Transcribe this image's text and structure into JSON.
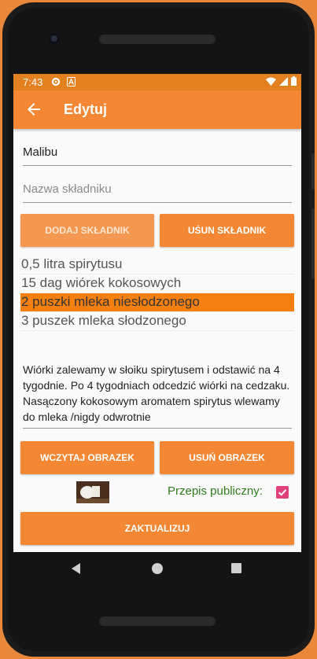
{
  "status_bar": {
    "time": "7:43"
  },
  "app_bar": {
    "title": "Edytuj"
  },
  "form": {
    "name_value": "Malibu",
    "ingredient_placeholder": "Nazwa składniku",
    "add_ingredient_label": "DODAJ SKŁADNIK",
    "remove_ingredient_label": "UŚUN SKŁADNIK"
  },
  "ingredients": [
    {
      "text": "0,5 litra spirytusu",
      "selected": false
    },
    {
      "text": "15 dag wiórek kokosowych",
      "selected": false
    },
    {
      "text": "2 puszki mleka niesłodzonego",
      "selected": true
    },
    {
      "text": "3 puszek mleka słodzonego",
      "selected": false
    }
  ],
  "description": "Wiórki zalewamy w słoiku spirytusem i odstawić na 4 tygodnie. Po 4 tygodniach odcedzić wiórki na cedzaku. Nasączony kokosowym aromatem spirytus wlewamy do mleka /nigdy odwrotnie",
  "image_buttons": {
    "load_label": "WCZYTAJ OBRAZEK",
    "remove_label": "USUŃ OBRAZEK"
  },
  "public": {
    "label": "Przepis publiczny:",
    "checked": true
  },
  "update_label": "ZAKTUALIZUJ",
  "colors": {
    "primary": "#f48734",
    "status_bar": "#e3801f",
    "selected_row": "#f5800f",
    "checkbox": "#e0407c",
    "public_label": "#2e7d1a"
  },
  "icons": {
    "status": [
      "settings-icon",
      "a-badge-icon",
      "wifi-icon",
      "signal-icon",
      "battery-icon"
    ],
    "back": "arrow-back-icon",
    "nav": [
      "nav-back-icon",
      "nav-home-icon",
      "nav-recents-icon"
    ]
  }
}
